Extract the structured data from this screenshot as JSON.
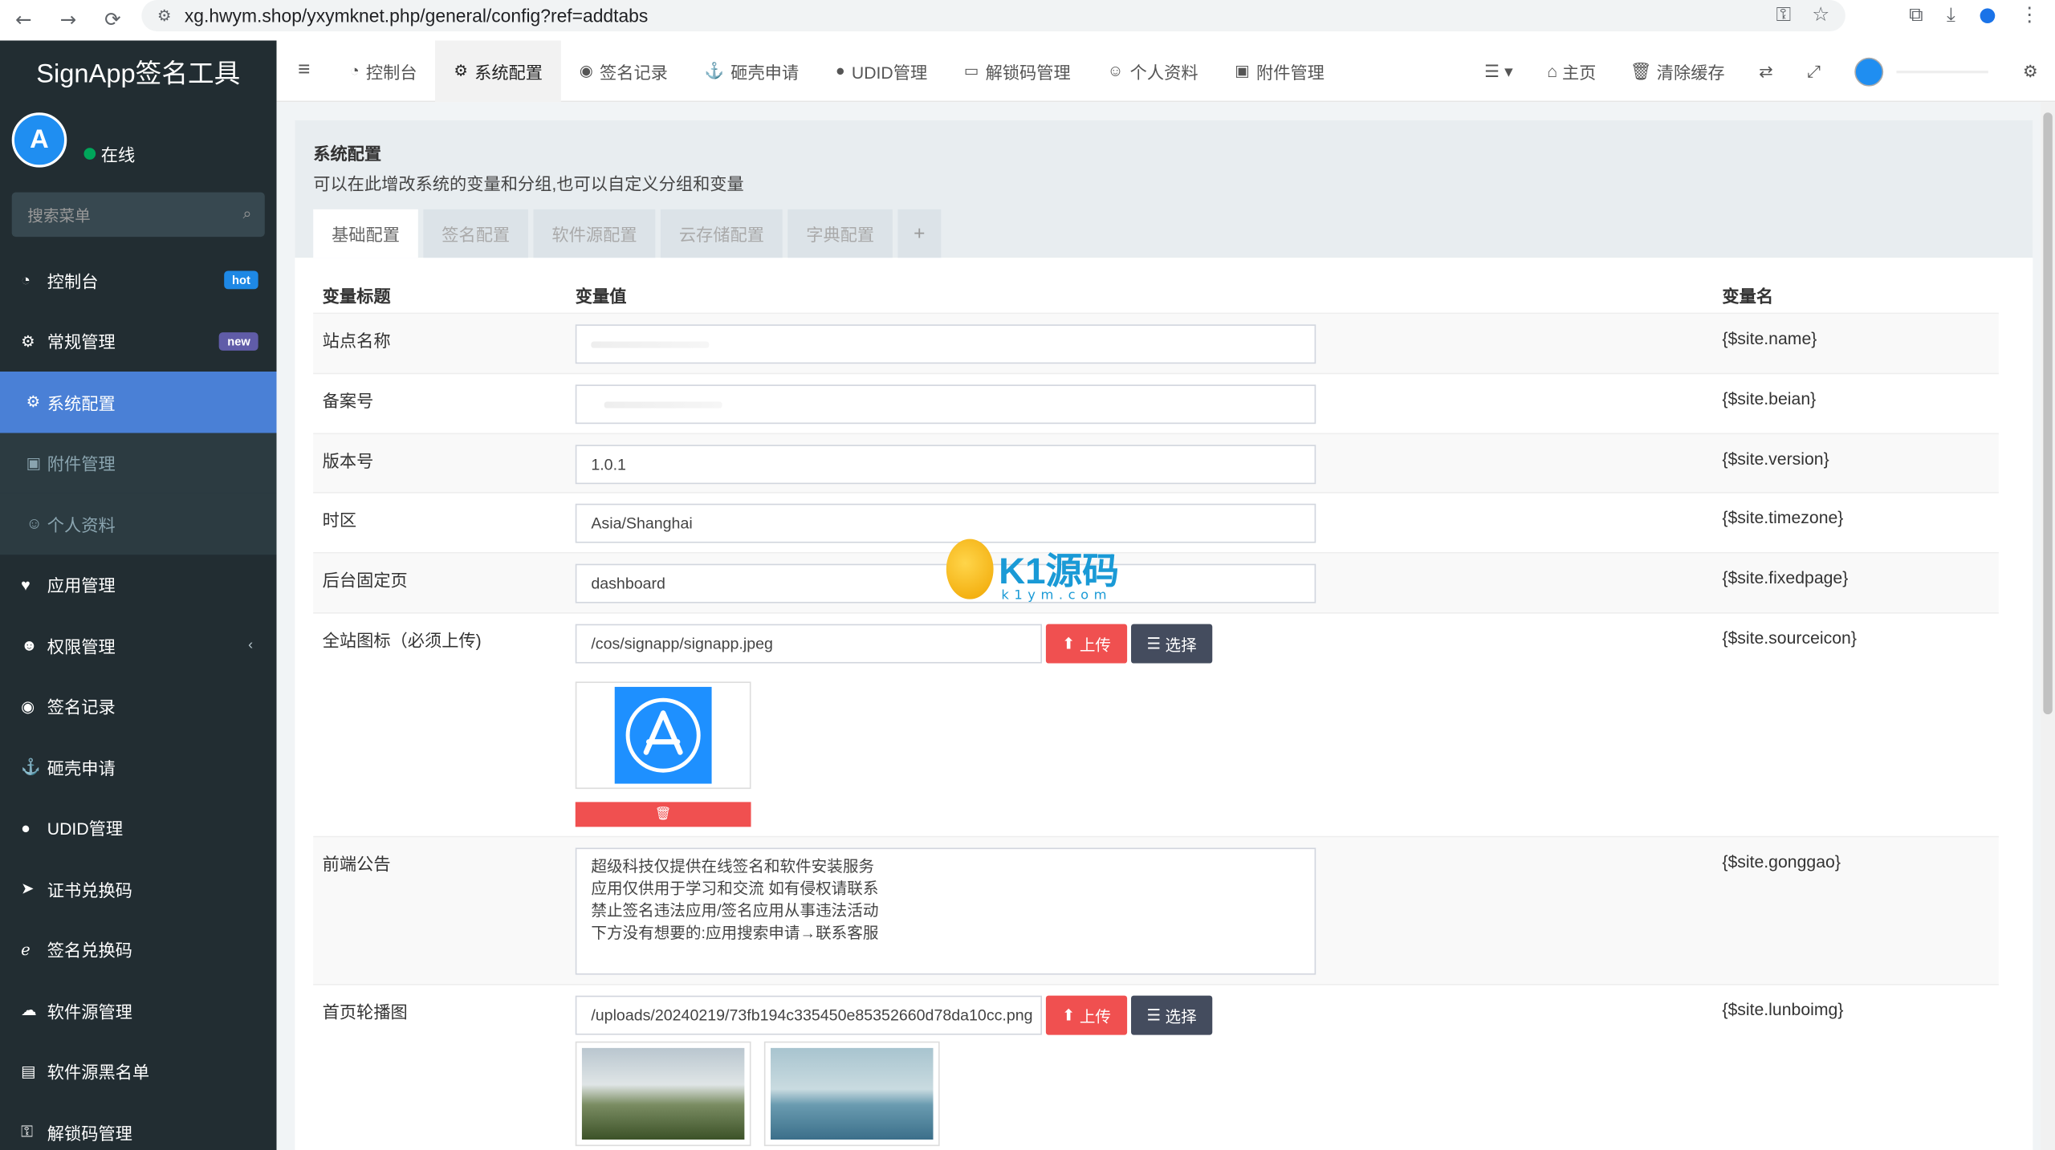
{
  "browser": {
    "url": "xg.hwym.shop/yxymknet.php/general/config?ref=addtabs"
  },
  "sidebar": {
    "logo": "SignApp签名工具",
    "status": "在线",
    "search_placeholder": "搜索菜单",
    "items": [
      {
        "label": "控制台",
        "badge": "hot"
      },
      {
        "label": "常规管理",
        "badge": "new"
      },
      {
        "label": "系统配置"
      },
      {
        "label": "附件管理"
      },
      {
        "label": "个人资料"
      },
      {
        "label": "应用管理"
      },
      {
        "label": "权限管理"
      },
      {
        "label": "签名记录"
      },
      {
        "label": "砸壳申请"
      },
      {
        "label": "UDID管理"
      },
      {
        "label": "证书兑换码"
      },
      {
        "label": "签名兑换码"
      },
      {
        "label": "软件源管理"
      },
      {
        "label": "软件源黑名单"
      },
      {
        "label": "解锁码管理"
      }
    ]
  },
  "topnav": {
    "tabs": [
      "控制台",
      "系统配置",
      "签名记录",
      "砸壳申请",
      "UDID管理",
      "解锁码管理",
      "个人资料",
      "附件管理"
    ],
    "home": "主页",
    "clear_cache": "清除缓存"
  },
  "panel": {
    "title": "系统配置",
    "desc": "可以在此增改系统的变量和分组,也可以自定义分组和变量",
    "tabs": [
      "基础配置",
      "签名配置",
      "软件源配置",
      "云存储配置",
      "字典配置"
    ],
    "add_tab": "+"
  },
  "table": {
    "headers": {
      "title": "变量标题",
      "value": "变量值",
      "name": "变量名"
    },
    "rows": [
      {
        "title": "站点名称",
        "value": "",
        "name": "{$site.name}"
      },
      {
        "title": "备案号",
        "value": "",
        "name": "{$site.beian}"
      },
      {
        "title": "版本号",
        "value": "1.0.1",
        "name": "{$site.version}"
      },
      {
        "title": "时区",
        "value": "Asia/Shanghai",
        "name": "{$site.timezone}"
      },
      {
        "title": "后台固定页",
        "value": "dashboard",
        "name": "{$site.fixedpage}"
      },
      {
        "title": "全站图标（必须上传)",
        "value": "/cos/signapp/signapp.jpeg",
        "name": "{$site.sourceicon}"
      },
      {
        "title": "前端公告",
        "value": "超级科技仅提供在线签名和软件安装服务\n应用仅供用于学习和交流  如有侵权请联系\n禁止签名违法应用/签名应用从事违法活动\n下方没有想要的:应用搜索申请→联系客服",
        "name": "{$site.gonggao}"
      },
      {
        "title": "首页轮播图",
        "value": "/uploads/20240219/73fb194c335450e85352660d78da10cc.png",
        "name": "{$site.lunboimg}"
      }
    ],
    "upload_label": "上传",
    "select_label": "选择"
  },
  "watermark": {
    "text": "K1源码",
    "sub": "k1ym.com"
  }
}
